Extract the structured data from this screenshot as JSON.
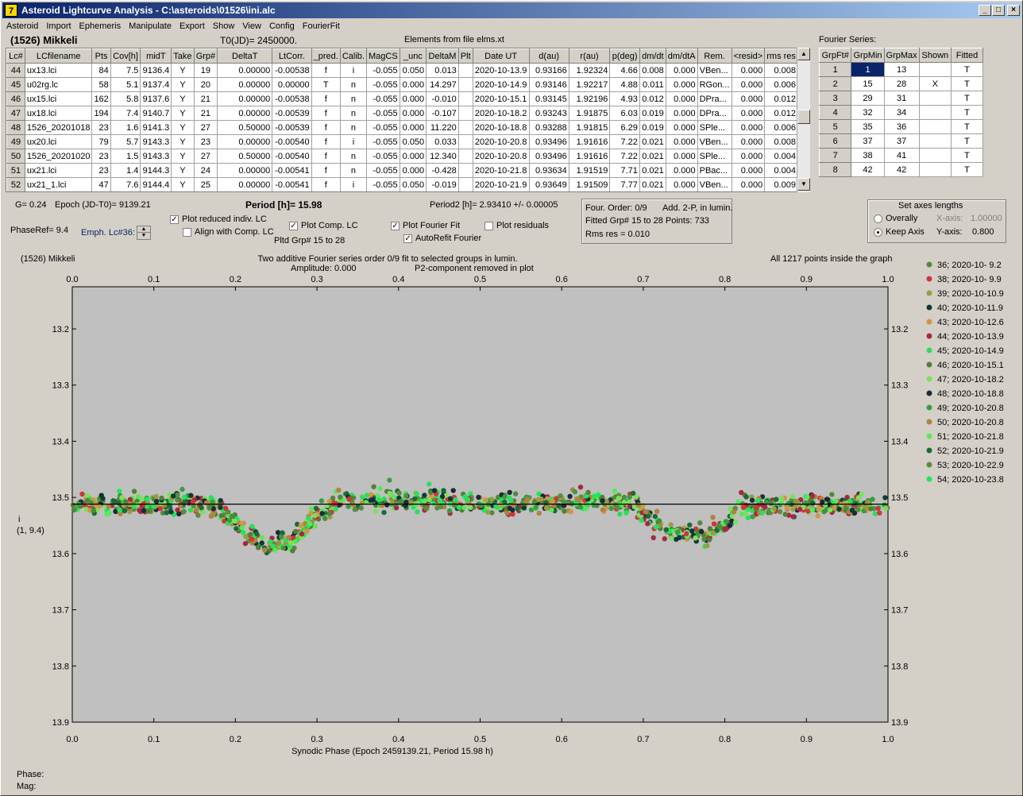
{
  "window": {
    "title": "Asteroid Lightcurve Analysis - C:\\asteroids\\01526\\ini.alc",
    "app_icon": "7"
  },
  "menu": [
    "Asteroid",
    "Import",
    "Ephemeris",
    "Manipulate",
    "Export",
    "Show",
    "View",
    "Config",
    "FourierFit"
  ],
  "header": {
    "asteroid": "(1526) Mikkeli",
    "t0": "T0(JD)= 2450000.",
    "elements": "Elements from file elms.xt",
    "fourier_series": "Fourier Series:"
  },
  "lc_table": {
    "columns": [
      "Lc#",
      "LCfilename",
      "Pts",
      "Cov[h]",
      "midT",
      "Take",
      "Grp#",
      "DeltaT",
      "LtCorr.",
      "_pred.",
      "Calib.",
      "MagCS",
      "_unc",
      "DeltaM",
      "Plt",
      "Date UT",
      "d(au)",
      "r(au)",
      "p(deg)",
      "dm/dt",
      "dm/dtA",
      "Rem.",
      "<resid>",
      "rms res"
    ],
    "rows": [
      [
        "44",
        "ux13.lci",
        "84",
        "7.5",
        "9136.4",
        "Y",
        "19",
        "0.00000",
        "-0.00538",
        "f",
        "i",
        "-0.055",
        "0.050",
        "0.013",
        "",
        "2020-10-13.9",
        "0.93166",
        "1.92324",
        "4.66",
        "0.008",
        "0.000",
        "VBen...",
        "0.000",
        "0.008"
      ],
      [
        "45",
        "u02rg.lc",
        "58",
        "5.1",
        "9137.4",
        "Y",
        "20",
        "0.00000",
        "0.00000",
        "T",
        "n",
        "-0.055",
        "0.000",
        "14.297",
        "",
        "2020-10-14.9",
        "0.93146",
        "1.92217",
        "4.88",
        "0.011",
        "0.000",
        "RGon...",
        "0.000",
        "0.006"
      ],
      [
        "46",
        "ux15.lci",
        "162",
        "5.8",
        "9137.6",
        "Y",
        "21",
        "0.00000",
        "-0.00538",
        "f",
        "n",
        "-0.055",
        "0.000",
        "-0.010",
        "",
        "2020-10-15.1",
        "0.93145",
        "1.92196",
        "4.93",
        "0.012",
        "0.000",
        "DPra...",
        "0.000",
        "0.012"
      ],
      [
        "47",
        "ux18.lci",
        "194",
        "7.4",
        "9140.7",
        "Y",
        "21",
        "0.00000",
        "-0.00539",
        "f",
        "n",
        "-0.055",
        "0.000",
        "-0.107",
        "",
        "2020-10-18.2",
        "0.93243",
        "1.91875",
        "6.03",
        "0.019",
        "0.000",
        "DPra...",
        "0.000",
        "0.012"
      ],
      [
        "48",
        "1526_20201018",
        "23",
        "1.6",
        "9141.3",
        "Y",
        "27",
        "0.50000",
        "-0.00539",
        "f",
        "n",
        "-0.055",
        "0.000",
        "11.220",
        "",
        "2020-10-18.8",
        "0.93288",
        "1.91815",
        "6.29",
        "0.019",
        "0.000",
        "SPle...",
        "0.000",
        "0.006"
      ],
      [
        "49",
        "ux20.lci",
        "79",
        "5.7",
        "9143.3",
        "Y",
        "23",
        "0.00000",
        "-0.00540",
        "f",
        "i",
        "-0.055",
        "0.050",
        "0.033",
        "",
        "2020-10-20.8",
        "0.93496",
        "1.91616",
        "7.22",
        "0.021",
        "0.000",
        "VBen...",
        "0.000",
        "0.008"
      ],
      [
        "50",
        "1526_20201020",
        "23",
        "1.5",
        "9143.3",
        "Y",
        "27",
        "0.50000",
        "-0.00540",
        "f",
        "n",
        "-0.055",
        "0.000",
        "12.340",
        "",
        "2020-10-20.8",
        "0.93496",
        "1.91616",
        "7.22",
        "0.021",
        "0.000",
        "SPle...",
        "0.000",
        "0.004"
      ],
      [
        "51",
        "ux21.lci",
        "23",
        "1.4",
        "9144.3",
        "Y",
        "24",
        "0.00000",
        "-0.00541",
        "f",
        "n",
        "-0.055",
        "0.000",
        "-0.428",
        "",
        "2020-10-21.8",
        "0.93634",
        "1.91519",
        "7.71",
        "0.021",
        "0.000",
        "PBac...",
        "0.000",
        "0.004"
      ],
      [
        "52",
        "ux21_1.lci",
        "47",
        "7.6",
        "9144.4",
        "Y",
        "25",
        "0.00000",
        "-0.00541",
        "f",
        "i",
        "-0.055",
        "0.050",
        "-0.019",
        "",
        "2020-10-21.9",
        "0.93649",
        "1.91509",
        "7.77",
        "0.021",
        "0.000",
        "VBen...",
        "0.000",
        "0.009"
      ]
    ]
  },
  "fs_table": {
    "columns": [
      "GrpFt#",
      "GrpMin",
      "GrpMax",
      "Shown",
      "Fitted"
    ],
    "rows": [
      [
        "1",
        "1",
        "13",
        "",
        "T"
      ],
      [
        "2",
        "15",
        "28",
        "X",
        "T"
      ],
      [
        "3",
        "29",
        "31",
        "",
        "T"
      ],
      [
        "4",
        "32",
        "34",
        "",
        "T"
      ],
      [
        "5",
        "35",
        "36",
        "",
        "T"
      ],
      [
        "6",
        "37",
        "37",
        "",
        "T"
      ],
      [
        "7",
        "38",
        "41",
        "",
        "T"
      ],
      [
        "8",
        "42",
        "42",
        "",
        "T"
      ]
    ]
  },
  "controls": {
    "g": "G= 0.24",
    "epoch": "Epoch (JD-T0)= 9139.21",
    "period": "Period [h]= 15.98",
    "period2": "Period2 [h]= 2.93410 +/- 0.00005",
    "phaseref": "PhaseRef= 9.4",
    "emph": "Emph. Lc#36:",
    "plot_reduced": "Plot reduced indiv. LC",
    "align": "Align with Comp. LC",
    "plot_comp": "Plot Comp. LC",
    "pltd_grp": "Pltd Grp#  15 to   28",
    "plot_fourier": "Plot Fourier Fit",
    "autorefit": "AutoRefit Fourier",
    "plot_residuals": "Plot residuals",
    "four_order": "Four. Order:  0/9",
    "add2p": "Add. 2-P, in lumin.",
    "fitted_grp": "Fitted Grp# 15 to 28 Points: 733",
    "rms": "Rms res      = 0.010",
    "axes_title": "Set axes lengths",
    "overally": "Overally",
    "keep_axis": "Keep Axis",
    "xaxis_label": "X-axis:",
    "xaxis_val": "1.00000",
    "yaxis_label": "Y-axis:",
    "yaxis_val": "0.800"
  },
  "plot": {
    "title_left": "(1526) Mikkeli",
    "title_center": "Two additive Fourier series order 0/9 fit to selected groups in lumin.",
    "amplitude": "Amplitude: 0.000",
    "p2": "P2-component removed in plot",
    "points_info": "All 1217 points inside the graph",
    "ylabel": "i",
    "ylabel2": "(1, 9.4)",
    "xlabel": "Synodic Phase (Epoch 2459139.21, Period 15.98 h)",
    "phase_label": "Phase:",
    "mag_label": "Mag:"
  },
  "chart_data": {
    "type": "scatter",
    "x_ticks": [
      "0.0",
      "0.1",
      "0.2",
      "0.3",
      "0.4",
      "0.5",
      "0.6",
      "0.7",
      "0.8",
      "0.9",
      "1.0"
    ],
    "y_ticks": [
      "13.2",
      "13.3",
      "13.4",
      "13.5",
      "13.6",
      "13.7",
      "13.8",
      "13.9"
    ],
    "xlim": [
      0,
      1
    ],
    "ylim": [
      13.9,
      13.125
    ],
    "fit_mag": 13.512,
    "series": [
      {
        "name": "36; 2020-10- 9.2",
        "color": "#4f8a3c"
      },
      {
        "name": "38; 2020-10- 9.9",
        "color": "#d2343c"
      },
      {
        "name": "39; 2020-10-10.9",
        "color": "#9c9a46"
      },
      {
        "name": "40; 2020-10-11.9",
        "color": "#0e3a36"
      },
      {
        "name": "43; 2020-10-12.6",
        "color": "#d0964a"
      },
      {
        "name": "44; 2020-10-13.9",
        "color": "#a82840"
      },
      {
        "name": "45; 2020-10-14.9",
        "color": "#2cde5a"
      },
      {
        "name": "46; 2020-10-15.1",
        "color": "#567e34"
      },
      {
        "name": "47; 2020-10-18.2",
        "color": "#7ee05a"
      },
      {
        "name": "48; 2020-10-18.8",
        "color": "#1c2a36"
      },
      {
        "name": "49; 2020-10-20.8",
        "color": "#3c9a46"
      },
      {
        "name": "50; 2020-10-20.8",
        "color": "#b2823e"
      },
      {
        "name": "51; 2020-10-21.8",
        "color": "#5ae85a"
      },
      {
        "name": "52; 2020-10-21.9",
        "color": "#1a6a3a"
      },
      {
        "name": "53; 2020-10-22.9",
        "color": "#5a8c3e"
      },
      {
        "name": "54; 2020-10-23.8",
        "color": "#1ee85a"
      }
    ],
    "profile": [
      [
        0.0,
        13.512
      ],
      [
        0.15,
        13.512
      ],
      [
        0.18,
        13.52
      ],
      [
        0.21,
        13.56
      ],
      [
        0.24,
        13.585
      ],
      [
        0.27,
        13.575
      ],
      [
        0.3,
        13.53
      ],
      [
        0.33,
        13.508
      ],
      [
        0.4,
        13.505
      ],
      [
        0.5,
        13.51
      ],
      [
        0.6,
        13.51
      ],
      [
        0.69,
        13.51
      ],
      [
        0.71,
        13.54
      ],
      [
        0.73,
        13.558
      ],
      [
        0.78,
        13.565
      ],
      [
        0.8,
        13.55
      ],
      [
        0.82,
        13.515
      ],
      [
        0.9,
        13.512
      ],
      [
        1.0,
        13.515
      ]
    ]
  }
}
